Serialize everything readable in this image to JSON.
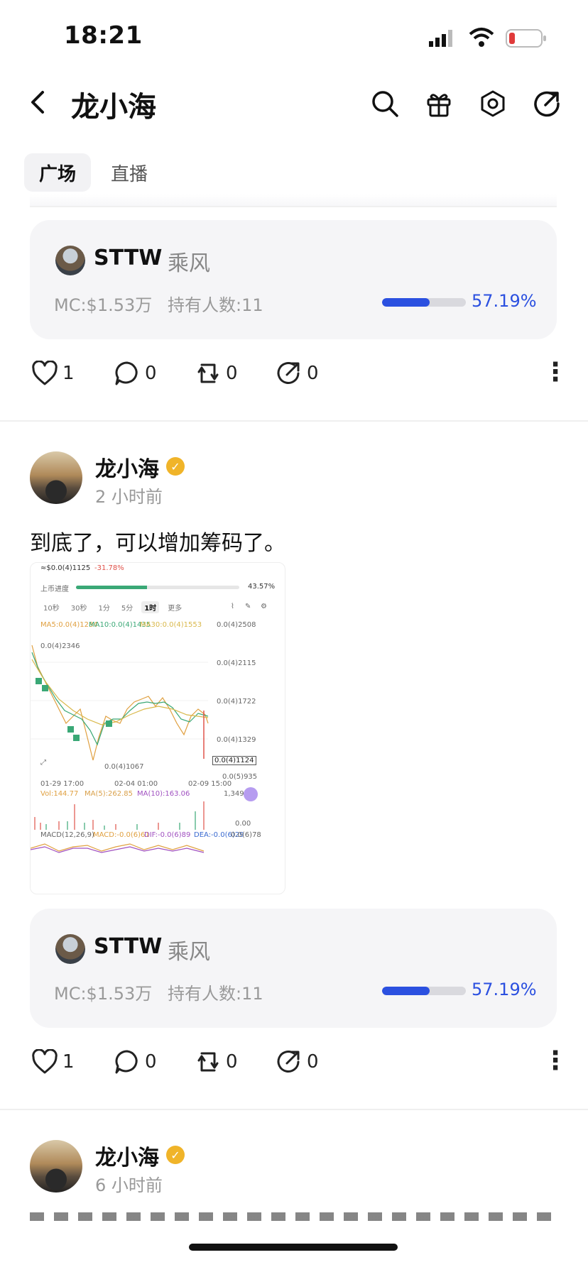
{
  "status_bar": {
    "time": "18:21"
  },
  "header": {
    "title": "龙小海"
  },
  "tabs": [
    {
      "label": "广场"
    },
    {
      "label": "直播"
    }
  ],
  "cards": [
    {
      "coin": "STTW",
      "tag": "乘风",
      "mc": "MC:$1.53万",
      "holders": "持有人数:11",
      "progress": 0.5719,
      "progress_text": "57.19%"
    },
    {
      "coin": "STTW",
      "tag": "乘风",
      "mc": "MC:$1.53万",
      "holders": "持有人数:11",
      "progress": 0.5719,
      "progress_text": "57.19%"
    }
  ],
  "actions": [
    {
      "like": "1",
      "comment": "0",
      "repost": "0",
      "share": "0"
    },
    {
      "like": "1",
      "comment": "0",
      "repost": "0",
      "share": "0"
    }
  ],
  "posts": [
    {
      "author": "龙小海",
      "time": "2 小时前",
      "text": "到底了，可以增加筹码了。"
    },
    {
      "author": "龙小海",
      "time": "6 小时前",
      "text": ""
    }
  ],
  "chart_image": {
    "price": "≈$0.0(4)1125",
    "change": "-31.78%",
    "progress_label": "上币进度",
    "progress": 0.4357,
    "progress_text": "43.57%",
    "intervals": [
      "10秒",
      "30秒",
      "1分",
      "5分",
      "1时",
      "更多"
    ],
    "ma": [
      "MA5:0.0(4)1284",
      "MA10:0.0(4)1435",
      "MA30:0.0(4)1553"
    ],
    "y_ticks": [
      "0.0(4)2508",
      "0.0(4)2115",
      "0.0(4)1722",
      "0.0(4)1329",
      "0.0(5)935"
    ],
    "high_label": "0.0(4)2346",
    "low_label": "0.0(4)1067",
    "last_label": "0.0(4)1124",
    "dates": [
      "01-29 17:00",
      "02-04 01:00",
      "02-09 15:00"
    ],
    "vol": [
      "Vol:144.77",
      "MA(5):262.85",
      "MA(10):163.06"
    ],
    "vol_ticks": [
      "1,349.2",
      "0.00"
    ],
    "macd": [
      "MACD(12,26,9)",
      "MACD:-0.0(6)61",
      "DIF:-0.0(6)89",
      "DEA:-0.0(6)29"
    ],
    "macd_tick": "0.0(6)78",
    "accent_green": "#3aa876",
    "accent_red": "#e0524a"
  }
}
